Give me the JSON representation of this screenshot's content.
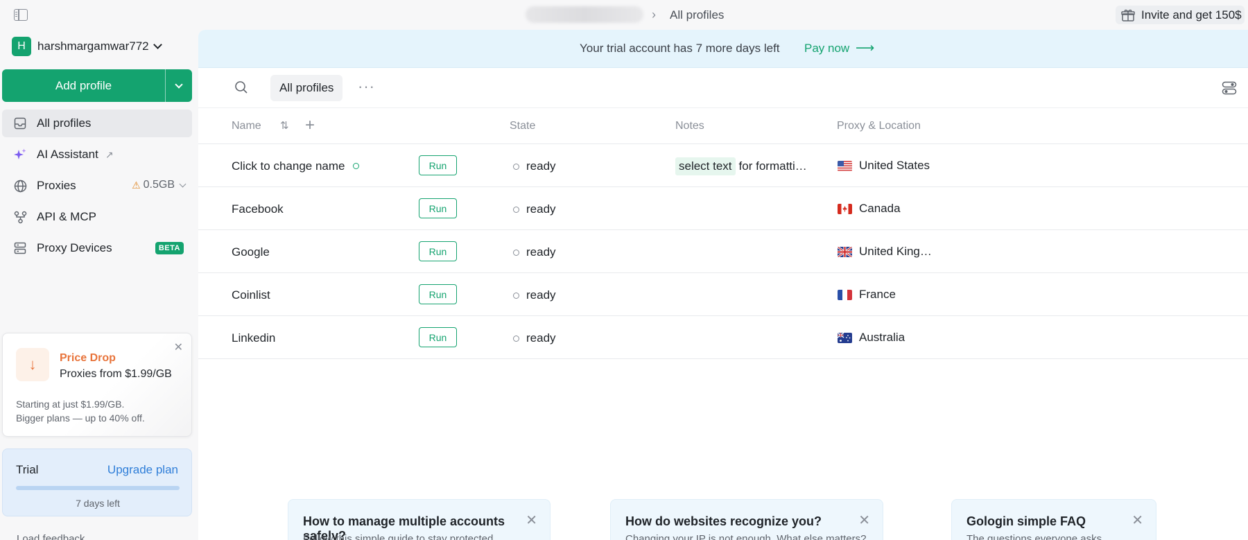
{
  "topbar": {
    "breadcrumb_separator": "›",
    "breadcrumb_current": "All profiles",
    "invite_label": "Invite and get 150$"
  },
  "sidebar": {
    "account_initial": "H",
    "account_name": "harshmargamwar772",
    "add_profile_label": "Add profile",
    "nav": {
      "all_profiles": "All profiles",
      "ai_assistant": "AI Assistant",
      "proxies": "Proxies",
      "proxies_usage": "0.5GB",
      "api_mcp": "API & MCP",
      "proxy_devices": "Proxy Devices",
      "proxy_devices_badge": "BETA"
    },
    "promo": {
      "title": "Price Drop",
      "subtitle": "Proxies from $1.99/GB",
      "line1": "Starting at just $1.99/GB.",
      "line2": "Bigger plans — up to 40% off."
    },
    "trial": {
      "label": "Trial",
      "upgrade_label": "Upgrade plan",
      "days_left": "7 days left"
    },
    "cut_off_item": "Load feedback"
  },
  "banner": {
    "text": "Your trial account has 7 more days left",
    "pay_label": "Pay now"
  },
  "toolbar": {
    "active_tab": "All profiles"
  },
  "table": {
    "columns": {
      "name": "Name",
      "state": "State",
      "notes": "Notes",
      "proxy": "Proxy & Location"
    },
    "run_label": "Run",
    "rows": [
      {
        "name": "Click to change name",
        "state": "ready",
        "note_tag": "select text",
        "note_text": "for formatti…",
        "location": "United States",
        "flag": "us"
      },
      {
        "name": "Facebook",
        "state": "ready",
        "note_tag": "",
        "note_text": "",
        "location": "Canada",
        "flag": "ca"
      },
      {
        "name": "Google",
        "state": "ready",
        "note_tag": "",
        "note_text": "",
        "location": "United King…",
        "flag": "gb"
      },
      {
        "name": "Coinlist",
        "state": "ready",
        "note_tag": "",
        "note_text": "",
        "location": "France",
        "flag": "fr"
      },
      {
        "name": "Linkedin",
        "state": "ready",
        "note_tag": "",
        "note_text": "",
        "location": "Australia",
        "flag": "au"
      }
    ]
  },
  "cards": [
    {
      "title": "How to manage multiple accounts safely?",
      "subtitle": "Follow this simple guide to stay protected"
    },
    {
      "title": "How do websites recognize you?",
      "subtitle": "Changing your IP is not enough. What else matters?"
    },
    {
      "title": "Gologin simple FAQ",
      "subtitle": "The questions everyone asks"
    }
  ],
  "colors": {
    "brand_green": "#14a36f",
    "banner_bg": "#e5f4fc",
    "promo_orange": "#e8743b",
    "link_blue": "#2f7ed8"
  },
  "icons": {
    "sidebar_toggle": "sidebar-toggle-icon",
    "gift": "gift-icon",
    "search": "search-icon",
    "more": "more-icon",
    "view_settings": "view-settings-icon"
  }
}
